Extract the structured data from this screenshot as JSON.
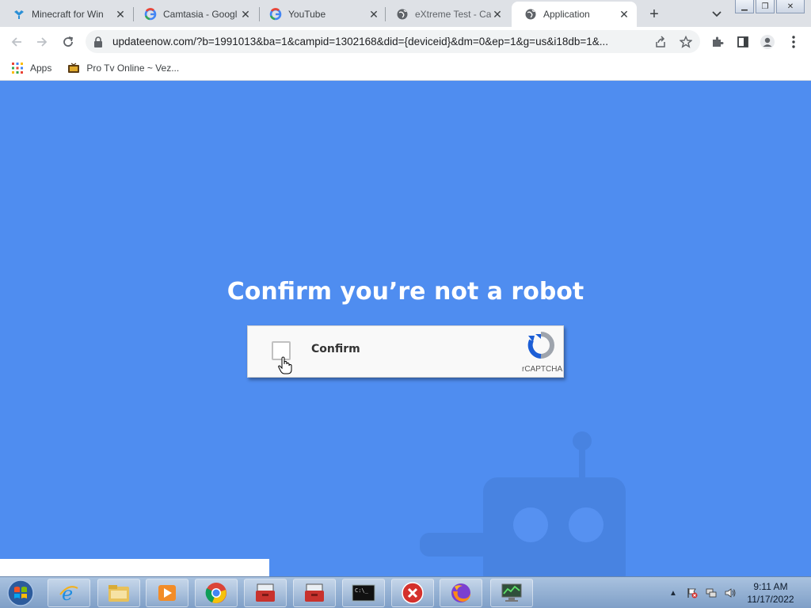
{
  "browser": {
    "tabs": [
      {
        "title": "Minecraft for Win",
        "icon": "minecraft-site-icon"
      },
      {
        "title": "Camtasia - Googl",
        "icon": "google-icon"
      },
      {
        "title": "YouTube",
        "icon": "google-icon"
      },
      {
        "title": "eXtreme Test - Ca",
        "icon": "globe-icon"
      },
      {
        "title": "Application",
        "icon": "globe-icon",
        "active": true
      }
    ],
    "url": "updateenow.com/?b=1991013&ba=1&campid=1302168&did={deviceid}&dm=0&ep=1&g=us&i18db=1&...",
    "bookmarks": [
      {
        "label": "Apps",
        "icon": "apps-grid-icon"
      },
      {
        "label": "Pro Tv Online ~ Vez...",
        "icon": "tv-icon"
      }
    ]
  },
  "page": {
    "heading": "Confirm you’re not a robot",
    "captcha": {
      "label": "Confirm",
      "brand": "rCAPTCHA"
    },
    "background_color": "#4f8df0"
  },
  "taskbar": {
    "apps": [
      "internet-explorer",
      "file-explorer",
      "media-player",
      "chrome",
      "toolbox-app",
      "toolbox-app-2",
      "command-prompt",
      "error-app",
      "firefox",
      "network-monitor"
    ],
    "clock": {
      "time": "9:11 AM",
      "date": "11/17/2022"
    }
  }
}
